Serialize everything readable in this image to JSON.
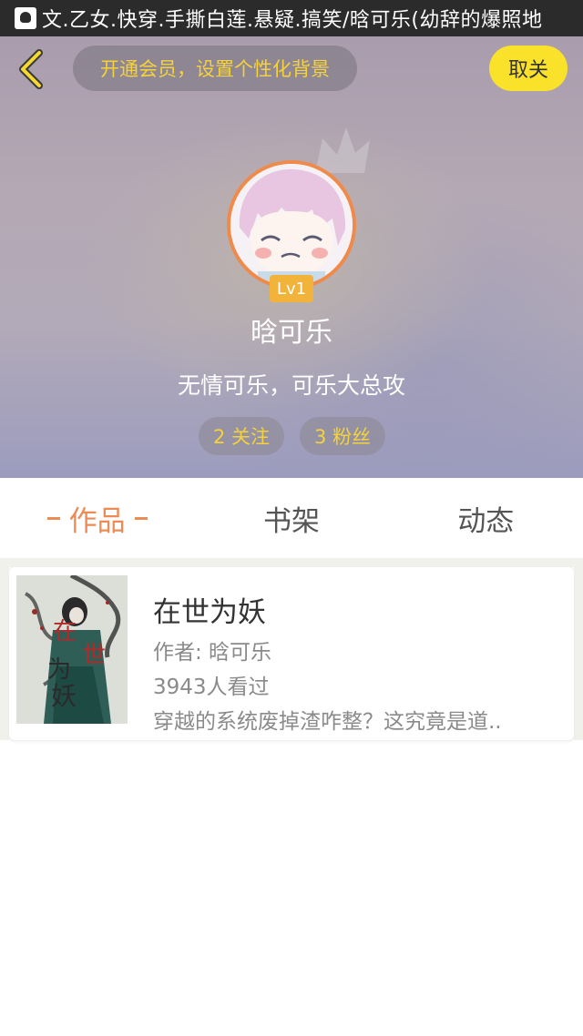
{
  "status_bar": {
    "title_text": "文.乙女.快穿.手撕白莲.悬疑.搞笑/晗可乐(幼辞的爆照地"
  },
  "header": {
    "back_icon": "chevron-left-icon",
    "member_prompt": "开通会员，设置个性化背景",
    "unfollow_label": "取关"
  },
  "profile": {
    "level": "Lv1",
    "username": "晗可乐",
    "signature": "无情可乐，可乐大总攻",
    "following": "2 关注",
    "followers": "3 粉丝"
  },
  "tabs": [
    {
      "label": "作品",
      "active": true
    },
    {
      "label": "书架",
      "active": false
    },
    {
      "label": "动态",
      "active": false
    }
  ],
  "works": [
    {
      "title": "在世为妖",
      "author": "作者: 晗可乐",
      "views": "3943人看过",
      "description": "穿越的系统废掉渣咋整？这究竟是道..",
      "cover_text": "在世为妖"
    }
  ],
  "colors": {
    "accent": "#ec8c55",
    "stat_text": "#f5d23a",
    "unfollow_bg": "#fbe22a",
    "level_badge": "#f2b33b"
  }
}
